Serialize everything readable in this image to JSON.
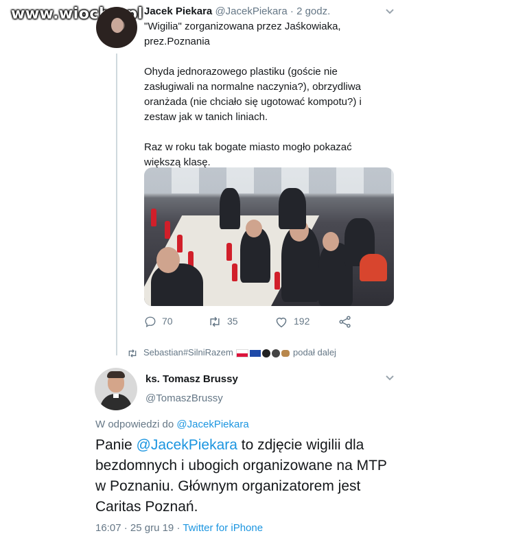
{
  "watermark": "www.wiocha.pl",
  "tweet1": {
    "name": "Jacek Piekara",
    "handle": "@JacekPiekara",
    "separator": " · ",
    "time": "2 godz.",
    "text": "\"Wigilia\" zorganizowana przez Jaśkowiaka,\nprez.Poznania\n\nOhyda jednorazowego plastiku (goście nie\nzasługiwali na normalne naczynia?), obrzydliwa\noranżada (nie chciało się ugotować kompotu?) i\nzestaw jak w tanich liniach.\n\nRaz w roku tak bogate miasto mogło pokazać\nwiększą klasę.",
    "replies": "70",
    "retweets": "35",
    "likes": "192"
  },
  "retweeted_by": {
    "name": "Sebastian#SilniRazem",
    "suffix": "podał dalej"
  },
  "tweet2": {
    "name": "ks. Tomasz Brussy",
    "handle": "@TomaszBrussy",
    "reply_prefix": "W odpowiedzi do ",
    "reply_handle": "@JacekPiekara",
    "text_prefix": "Panie ",
    "text_mention": "@JacekPiekara",
    "text_rest": " to zdjęcie wigilii dla bezdomnych i ubogich organizowane na MTP w Poznaniu. Głównym organizatorem jest Caritas Poznań.",
    "time": "16:07",
    "date": "25 gru 19",
    "source": "Twitter for iPhone"
  },
  "icons": {
    "reply": "reply-icon",
    "retweet": "retweet-icon",
    "like": "heart-icon",
    "share": "share-icon",
    "more": "chevron-down-icon"
  },
  "colors": {
    "link": "#1b95e0",
    "secondary": "#657786",
    "primary": "#14171a"
  }
}
